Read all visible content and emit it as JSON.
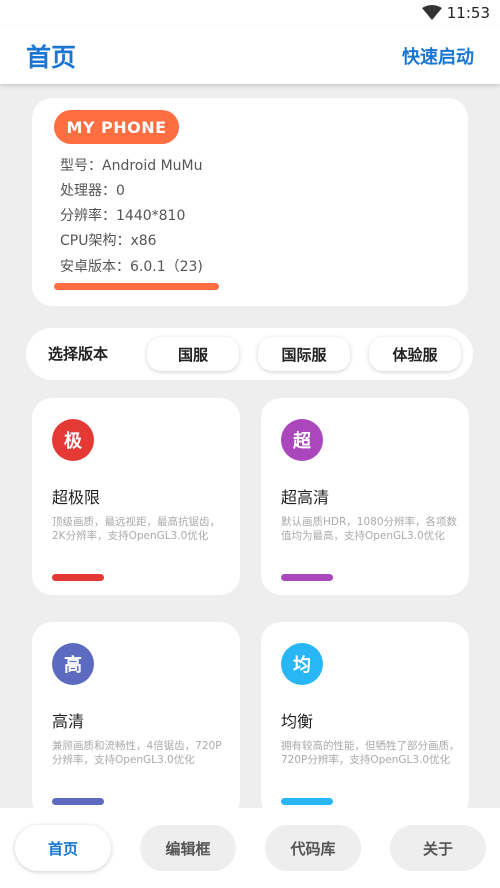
{
  "status": {
    "time": "11:53",
    "wifi_icon": "wifi-icon"
  },
  "appbar": {
    "title": "首页",
    "action": "快速启动"
  },
  "phone": {
    "badge": "MY PHONE",
    "specs": [
      "型号：Android MuMu",
      "处理器：0",
      "分辨率：1440*810",
      "CPU架构：x86",
      "安卓版本：6.0.1（23)"
    ]
  },
  "versions": {
    "label": "选择版本",
    "options": [
      "国服",
      "国际服",
      "体验服"
    ]
  },
  "modes": [
    {
      "icon_char": "极",
      "title": "超极限",
      "desc": "顶级画质，最远视距，最高抗锯齿，2K分辨率，支持OpenGL3.0优化",
      "color": "#e53935"
    },
    {
      "icon_char": "超",
      "title": "超高清",
      "desc": "默认画质HDR，1080分辨率，各项数值均为最高，支持OpenGL3.0优化",
      "color": "#ab47bc"
    },
    {
      "icon_char": "高",
      "title": "高清",
      "desc": "兼顾画质和流畅性，4倍锯齿，720P分辨率，支持OpenGL3.0优化",
      "color": "#5c6bc0"
    },
    {
      "icon_char": "均",
      "title": "均衡",
      "desc": "拥有较高的性能，但牺牲了部分画质，720P分辨率，支持OpenGL3.0优化",
      "color": "#29b6f6"
    }
  ],
  "nav": {
    "items": [
      "首页",
      "编辑框",
      "代码库",
      "关于"
    ],
    "active_color": "#1976d2"
  }
}
